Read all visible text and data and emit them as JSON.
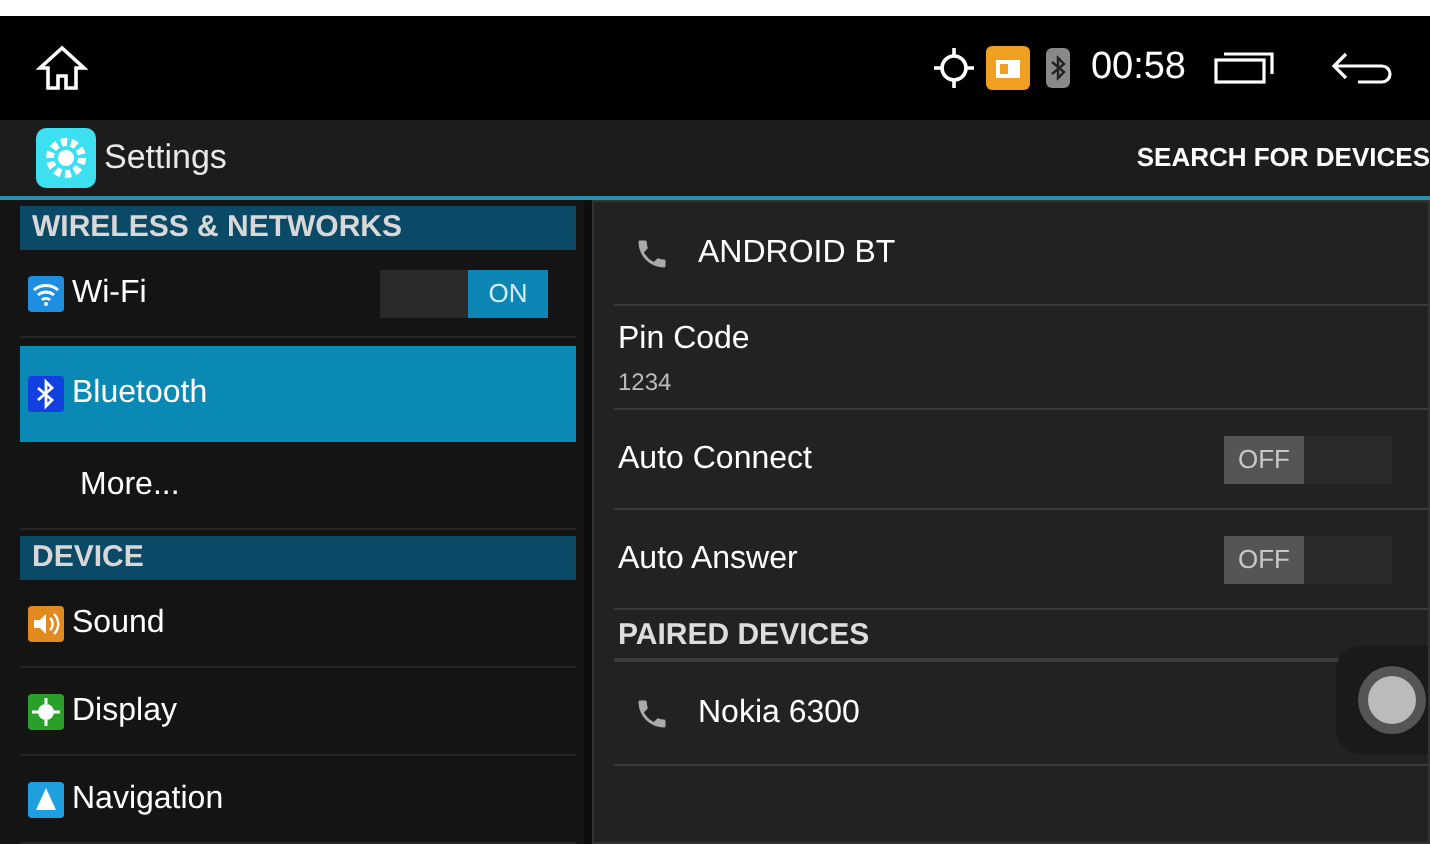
{
  "status_bar": {
    "time": "00:58"
  },
  "action_bar": {
    "title": "Settings",
    "action": "SEARCH FOR DEVICES"
  },
  "sidebar": [
    {
      "kind": "header",
      "label": "WIRELESS & NETWORKS"
    },
    {
      "kind": "item",
      "label": "Wi-Fi",
      "selected": false,
      "toggle": {
        "label": "ON",
        "on": true
      }
    },
    {
      "kind": "item",
      "label": "Bluetooth",
      "selected": true
    },
    {
      "kind": "item",
      "label": "More...",
      "selected": false
    },
    {
      "kind": "header",
      "label": "DEVICE"
    },
    {
      "kind": "item",
      "label": "Sound",
      "selected": false
    },
    {
      "kind": "item",
      "label": "Display",
      "selected": false
    },
    {
      "kind": "item",
      "label": "Navigation",
      "selected": false
    }
  ],
  "detail": [
    {
      "kind": "device",
      "label": "ANDROID BT"
    },
    {
      "kind": "value",
      "label": "Pin Code",
      "value": "1234"
    },
    {
      "kind": "toggle",
      "label": "Auto Connect",
      "toggle": {
        "label": "OFF",
        "on": false
      }
    },
    {
      "kind": "toggle",
      "label": "Auto Answer",
      "toggle": {
        "label": "OFF",
        "on": false
      }
    },
    {
      "kind": "header",
      "label": "PAIRED DEVICES"
    },
    {
      "kind": "device",
      "label": "Nokia 6300"
    }
  ]
}
